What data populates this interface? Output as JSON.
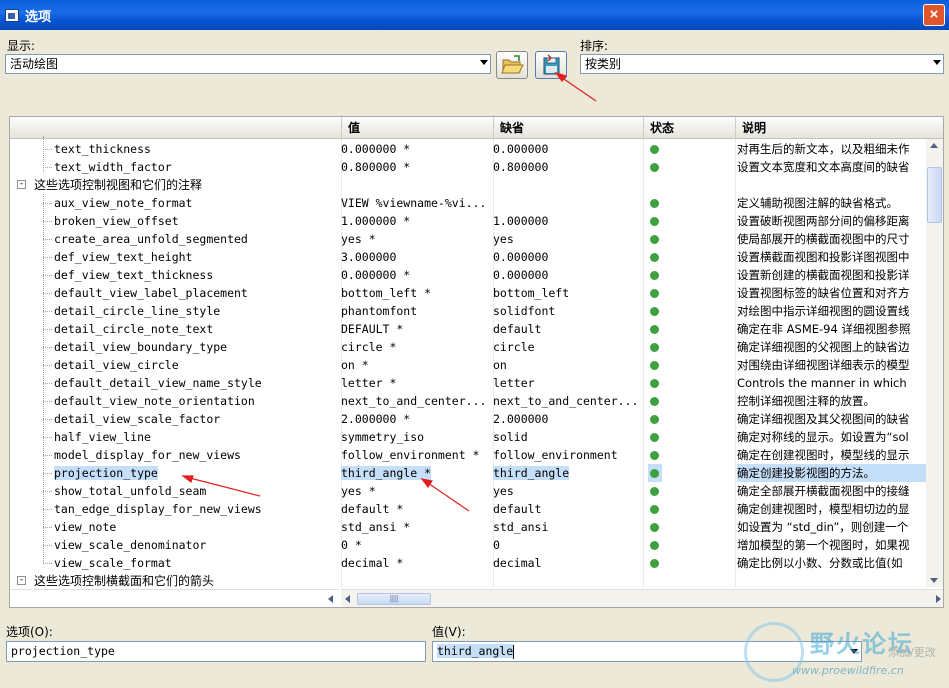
{
  "window": {
    "title": "选项",
    "close_label": "×"
  },
  "display": {
    "label": "显示:",
    "value": "活动绘图"
  },
  "sort": {
    "label": "排序:",
    "value": "按类别"
  },
  "toolbar": {
    "open_icon": "folder-open-icon",
    "save_icon": "save-disk-icon"
  },
  "table": {
    "headers": {
      "name": "",
      "value": "值",
      "default": "缺省",
      "status": "状态",
      "description": "说明"
    },
    "top_rows": [
      {
        "name": "text_thickness",
        "value": "0.000000 *",
        "default": "0.000000",
        "desc": "对再生后的新文本，以及粗细未作"
      },
      {
        "name": "text_width_factor",
        "value": "0.800000 *",
        "default": "0.800000",
        "desc": "设置文本宽度和文本高度间的缺省"
      }
    ],
    "group1": "这些选项控制视图和它们的注释",
    "rows": [
      {
        "name": "aux_view_note_format",
        "value": "VIEW %viewname-%vi...",
        "default": "",
        "desc": "定义辅助视图注解的缺省格式。"
      },
      {
        "name": "broken_view_offset",
        "value": "1.000000 *",
        "default": "1.000000",
        "desc": "设置破断视图两部分间的偏移距离"
      },
      {
        "name": "create_area_unfold_segmented",
        "value": "yes *",
        "default": "yes",
        "desc": "使局部展开的横截面视图中的尺寸"
      },
      {
        "name": "def_view_text_height",
        "value": "3.000000",
        "default": "0.000000",
        "desc": "设置横截面视图和投影详图视图中"
      },
      {
        "name": "def_view_text_thickness",
        "value": "0.000000 *",
        "default": "0.000000",
        "desc": "设置新创建的横截面视图和投影详"
      },
      {
        "name": "default_view_label_placement",
        "value": "bottom_left *",
        "default": "bottom_left",
        "desc": "设置视图标签的缺省位置和对齐方"
      },
      {
        "name": "detail_circle_line_style",
        "value": "phantomfont",
        "default": "solidfont",
        "desc": "对绘图中指示详细视图的圆设置线"
      },
      {
        "name": "detail_circle_note_text",
        "value": "DEFAULT *",
        "default": "default",
        "desc": "确定在非 ASME-94 详细视图参照"
      },
      {
        "name": "detail_view_boundary_type",
        "value": "circle *",
        "default": "circle",
        "desc": "确定详细视图的父视图上的缺省边"
      },
      {
        "name": "detail_view_circle",
        "value": "on *",
        "default": "on",
        "desc": "对围绕由详细视图详细表示的模型"
      },
      {
        "name": "default_detail_view_name_style",
        "value": "letter *",
        "default": "letter",
        "desc": "Controls the manner in which"
      },
      {
        "name": "default_view_note_orientation",
        "value": "next_to_and_center...",
        "default": "next_to_and_center...",
        "desc": "控制详细视图注释的放置。"
      },
      {
        "name": "detail_view_scale_factor",
        "value": "2.000000 *",
        "default": "2.000000",
        "desc": "确定详细视图及其父视图间的缺省"
      },
      {
        "name": "half_view_line",
        "value": "symmetry_iso",
        "default": "solid",
        "desc": "确定对称线的显示。如设置为“sol"
      },
      {
        "name": "model_display_for_new_views",
        "value": "follow_environment *",
        "default": "follow_environment",
        "desc": "确定在创建视图时，模型线的显示"
      },
      {
        "name": "projection_type",
        "value": "third_angle *",
        "default": "third_angle",
        "desc": "确定创建投影视图的方法。"
      },
      {
        "name": "show_total_unfold_seam",
        "value": "yes *",
        "default": "yes",
        "desc": "确定全部展开横截面视图中的接缝"
      },
      {
        "name": "tan_edge_display_for_new_views",
        "value": "default *",
        "default": "default",
        "desc": "确定创建视图时，模型相切边的显"
      },
      {
        "name": "view_note",
        "value": "std_ansi *",
        "default": "std_ansi",
        "desc": "如设置为 “std_din”，则创建一个"
      },
      {
        "name": "view_scale_denominator",
        "value": "0 *",
        "default": "0",
        "desc": "增加模型的第一个视图时，如果视"
      },
      {
        "name": "view_scale_format",
        "value": "decimal *",
        "default": "decimal",
        "desc": "确定比例以小数、分数或比值(如"
      }
    ],
    "group2": "这些选项控制横截面和它们的箭头",
    "hscroll_grip": "||||"
  },
  "option_field": {
    "label": "选项(O):",
    "value": "projection_type"
  },
  "value_field": {
    "label": "值(V):",
    "value": "third_angle"
  },
  "watermark": {
    "title": "野火论坛",
    "url": "www.proewildfire.cn",
    "side": "添加/更改"
  },
  "colors": {
    "selection": "#c6dff8",
    "status_green": "#3ea040",
    "arrow_red": "#e02020",
    "titlebar": "#0a5fd8"
  }
}
